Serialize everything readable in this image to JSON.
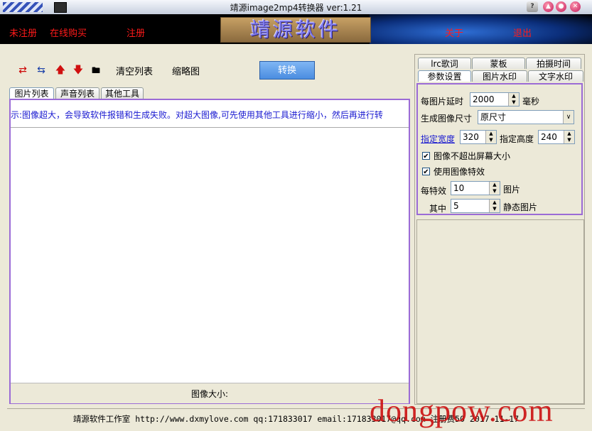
{
  "window": {
    "title": "靖源image2mp4转换器 ver:1.21",
    "help_glyph": "?"
  },
  "banner": {
    "links": [
      "未注册",
      "在线购买",
      "注册",
      "关于",
      "退出"
    ],
    "logo": "靖源软件"
  },
  "toolbar": {
    "clear_list": "清空列表",
    "thumbnail": "缩略图",
    "convert": "转换"
  },
  "left_tabs": [
    "图片列表",
    "声音列表",
    "其他工具"
  ],
  "left_pane": {
    "notice": "示:图像超大，会导致软件报错和生成失败。对超大图像,可先使用其他工具进行缩小，然后再进行转",
    "image_size_label": "图像大小:"
  },
  "right_tabs": {
    "row1": [
      "lrc歌词",
      "蒙板",
      "拍摄时间"
    ],
    "row2": [
      "参数设置",
      "图片水印",
      "文字水印"
    ]
  },
  "settings": {
    "delay_label": "每图片延时",
    "delay_value": "2000",
    "delay_unit": "毫秒",
    "size_label": "生成图像尺寸",
    "size_value": "原尺寸",
    "width_link": "指定宽度",
    "width_value": "320",
    "height_label": "指定高度",
    "height_value": "240",
    "no_exceed_screen": "图像不超出屏幕大小",
    "use_effects": "使用图像特效",
    "per_effect_label": "每特效",
    "per_effect_value": "10",
    "per_effect_unit": "图片",
    "among_label": "其中",
    "among_value": "5",
    "among_unit": "静态图片"
  },
  "status_bar": {
    "text": "靖源软件工作室 http://www.dxmylove.com qq:171833017 email:171833017@qq.com 注册费50 2017-11-17"
  },
  "watermark": "dongpow.com"
}
